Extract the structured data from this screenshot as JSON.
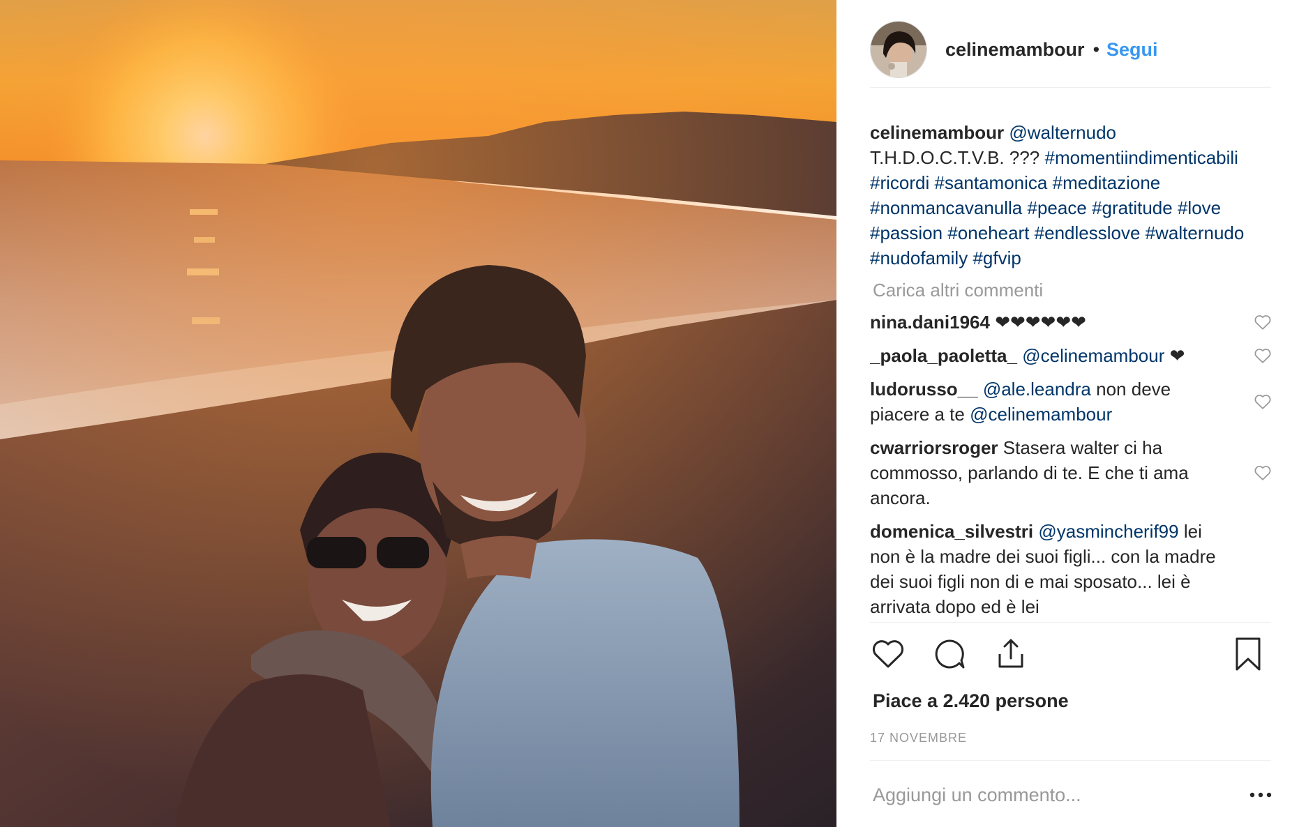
{
  "post": {
    "author": "celinemambour",
    "follow_label": "Segui",
    "separator": "•"
  },
  "caption": {
    "user": "celinemambour",
    "mention": "@walternudo",
    "text": "T.H.D.O.C.T.V.B. ???",
    "tags": [
      "#momentiindimenticabili",
      "#ricordi",
      "#santamonica",
      "#meditazione",
      "#nonmancavanulla",
      "#peace",
      "#gratitude",
      "#love",
      "#passion",
      "#oneheart",
      "#endlesslove",
      "#walternudo",
      "#nudofamily",
      "#gfvip"
    ]
  },
  "load_more_label": "Carica altri commenti",
  "comments": [
    {
      "user": "nina.dani1964",
      "mention": "",
      "text": "❤❤❤❤❤❤",
      "mention2": "",
      "text2": ""
    },
    {
      "user": "_paola_paoletta_",
      "mention": "@celinemambour",
      "text": "❤",
      "mention2": "",
      "text2": ""
    },
    {
      "user": "ludorusso__",
      "mention": "@ale.leandra",
      "text": "non deve piacere a te",
      "mention2": "@celinemambour",
      "text2": ""
    },
    {
      "user": "cwarriorsroger",
      "mention": "",
      "text": "Stasera walter ci ha commosso, parlando di te. E che ti ama ancora.",
      "mention2": "",
      "text2": ""
    },
    {
      "user": "domenica_silvestri",
      "mention": "@yasmincherif99",
      "text": "lei non è la madre dei suoi figli... con la madre dei suoi figli non di e mai sposato... lei è arrivata dopo ed è lei",
      "mention2": "",
      "text2": ""
    }
  ],
  "likes_label": "Piace a 2.420 persone",
  "date_label": "17 NOVEMBRE",
  "add_comment_placeholder": "Aggiungi un commento...",
  "more_options_label": "•••",
  "icons": {
    "like": "heart-icon",
    "comment": "comment-bubble-icon",
    "share": "share-icon",
    "save": "bookmark-icon",
    "comment_like": "heart-outline-icon"
  }
}
